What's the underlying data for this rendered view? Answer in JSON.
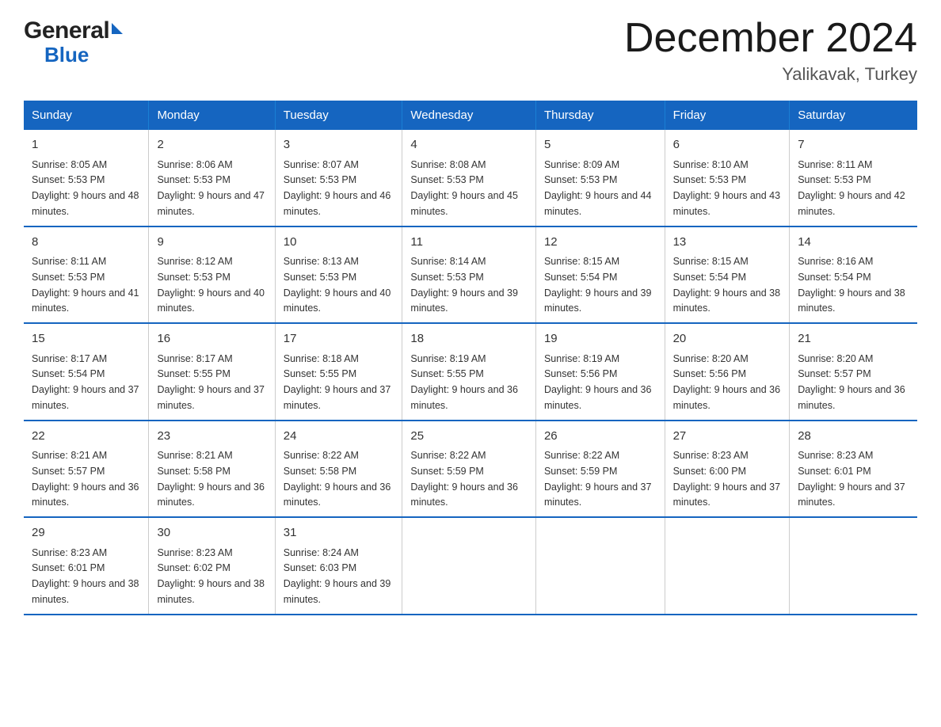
{
  "logo": {
    "general": "General",
    "blue": "Blue"
  },
  "title": "December 2024",
  "subtitle": "Yalikavak, Turkey",
  "days_of_week": [
    "Sunday",
    "Monday",
    "Tuesday",
    "Wednesday",
    "Thursday",
    "Friday",
    "Saturday"
  ],
  "weeks": [
    [
      {
        "day": "1",
        "sunrise": "8:05 AM",
        "sunset": "5:53 PM",
        "daylight": "9 hours and 48 minutes."
      },
      {
        "day": "2",
        "sunrise": "8:06 AM",
        "sunset": "5:53 PM",
        "daylight": "9 hours and 47 minutes."
      },
      {
        "day": "3",
        "sunrise": "8:07 AM",
        "sunset": "5:53 PM",
        "daylight": "9 hours and 46 minutes."
      },
      {
        "day": "4",
        "sunrise": "8:08 AM",
        "sunset": "5:53 PM",
        "daylight": "9 hours and 45 minutes."
      },
      {
        "day": "5",
        "sunrise": "8:09 AM",
        "sunset": "5:53 PM",
        "daylight": "9 hours and 44 minutes."
      },
      {
        "day": "6",
        "sunrise": "8:10 AM",
        "sunset": "5:53 PM",
        "daylight": "9 hours and 43 minutes."
      },
      {
        "day": "7",
        "sunrise": "8:11 AM",
        "sunset": "5:53 PM",
        "daylight": "9 hours and 42 minutes."
      }
    ],
    [
      {
        "day": "8",
        "sunrise": "8:11 AM",
        "sunset": "5:53 PM",
        "daylight": "9 hours and 41 minutes."
      },
      {
        "day": "9",
        "sunrise": "8:12 AM",
        "sunset": "5:53 PM",
        "daylight": "9 hours and 40 minutes."
      },
      {
        "day": "10",
        "sunrise": "8:13 AM",
        "sunset": "5:53 PM",
        "daylight": "9 hours and 40 minutes."
      },
      {
        "day": "11",
        "sunrise": "8:14 AM",
        "sunset": "5:53 PM",
        "daylight": "9 hours and 39 minutes."
      },
      {
        "day": "12",
        "sunrise": "8:15 AM",
        "sunset": "5:54 PM",
        "daylight": "9 hours and 39 minutes."
      },
      {
        "day": "13",
        "sunrise": "8:15 AM",
        "sunset": "5:54 PM",
        "daylight": "9 hours and 38 minutes."
      },
      {
        "day": "14",
        "sunrise": "8:16 AM",
        "sunset": "5:54 PM",
        "daylight": "9 hours and 38 minutes."
      }
    ],
    [
      {
        "day": "15",
        "sunrise": "8:17 AM",
        "sunset": "5:54 PM",
        "daylight": "9 hours and 37 minutes."
      },
      {
        "day": "16",
        "sunrise": "8:17 AM",
        "sunset": "5:55 PM",
        "daylight": "9 hours and 37 minutes."
      },
      {
        "day": "17",
        "sunrise": "8:18 AM",
        "sunset": "5:55 PM",
        "daylight": "9 hours and 37 minutes."
      },
      {
        "day": "18",
        "sunrise": "8:19 AM",
        "sunset": "5:55 PM",
        "daylight": "9 hours and 36 minutes."
      },
      {
        "day": "19",
        "sunrise": "8:19 AM",
        "sunset": "5:56 PM",
        "daylight": "9 hours and 36 minutes."
      },
      {
        "day": "20",
        "sunrise": "8:20 AM",
        "sunset": "5:56 PM",
        "daylight": "9 hours and 36 minutes."
      },
      {
        "day": "21",
        "sunrise": "8:20 AM",
        "sunset": "5:57 PM",
        "daylight": "9 hours and 36 minutes."
      }
    ],
    [
      {
        "day": "22",
        "sunrise": "8:21 AM",
        "sunset": "5:57 PM",
        "daylight": "9 hours and 36 minutes."
      },
      {
        "day": "23",
        "sunrise": "8:21 AM",
        "sunset": "5:58 PM",
        "daylight": "9 hours and 36 minutes."
      },
      {
        "day": "24",
        "sunrise": "8:22 AM",
        "sunset": "5:58 PM",
        "daylight": "9 hours and 36 minutes."
      },
      {
        "day": "25",
        "sunrise": "8:22 AM",
        "sunset": "5:59 PM",
        "daylight": "9 hours and 36 minutes."
      },
      {
        "day": "26",
        "sunrise": "8:22 AM",
        "sunset": "5:59 PM",
        "daylight": "9 hours and 37 minutes."
      },
      {
        "day": "27",
        "sunrise": "8:23 AM",
        "sunset": "6:00 PM",
        "daylight": "9 hours and 37 minutes."
      },
      {
        "day": "28",
        "sunrise": "8:23 AM",
        "sunset": "6:01 PM",
        "daylight": "9 hours and 37 minutes."
      }
    ],
    [
      {
        "day": "29",
        "sunrise": "8:23 AM",
        "sunset": "6:01 PM",
        "daylight": "9 hours and 38 minutes."
      },
      {
        "day": "30",
        "sunrise": "8:23 AM",
        "sunset": "6:02 PM",
        "daylight": "9 hours and 38 minutes."
      },
      {
        "day": "31",
        "sunrise": "8:24 AM",
        "sunset": "6:03 PM",
        "daylight": "9 hours and 39 minutes."
      },
      null,
      null,
      null,
      null
    ]
  ]
}
